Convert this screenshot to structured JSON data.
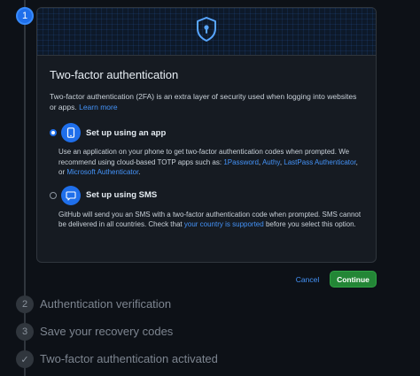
{
  "steps": [
    {
      "number": "1",
      "state": "active"
    },
    {
      "number": "2",
      "label": "Authentication verification"
    },
    {
      "number": "3",
      "label": "Save your recovery codes"
    },
    {
      "number": "✓",
      "label": "Two-factor authentication activated"
    }
  ],
  "card": {
    "title": "Two-factor authentication",
    "intro_text": "Two-factor authentication (2FA) is an extra layer of security used when logging into websites or apps.",
    "learn_more": "Learn more",
    "app_option": {
      "label": "Set up using an app",
      "selected": true,
      "desc_prefix": "Use an application on your phone to get two-factor authentication codes when prompted. We recommend using cloud-based TOTP apps such as:",
      "apps": [
        "1Password",
        "Authy",
        "LastPass Authenticator",
        "Microsoft Authenticator"
      ],
      "sep1": ",",
      "sep2": ",",
      "sep3": ", or",
      "end": "."
    },
    "sms_option": {
      "label": "Set up using SMS",
      "selected": false,
      "desc_prefix": "GitHub will send you an SMS with a two-factor authentication code when prompted. SMS cannot be delivered in all countries. Check that",
      "link": "your country is supported",
      "desc_suffix": "before you select this option."
    }
  },
  "actions": {
    "cancel": "Cancel",
    "continue": "Continue"
  },
  "colors": {
    "background": "#0d1117",
    "accent": "#1f6feb",
    "link": "#4493f8",
    "primary_button": "#238636"
  },
  "icons": {
    "banner": "shield-lock-icon",
    "app": "mobile-phone-icon",
    "sms": "chat-bubble-icon",
    "step_done": "check-icon"
  }
}
